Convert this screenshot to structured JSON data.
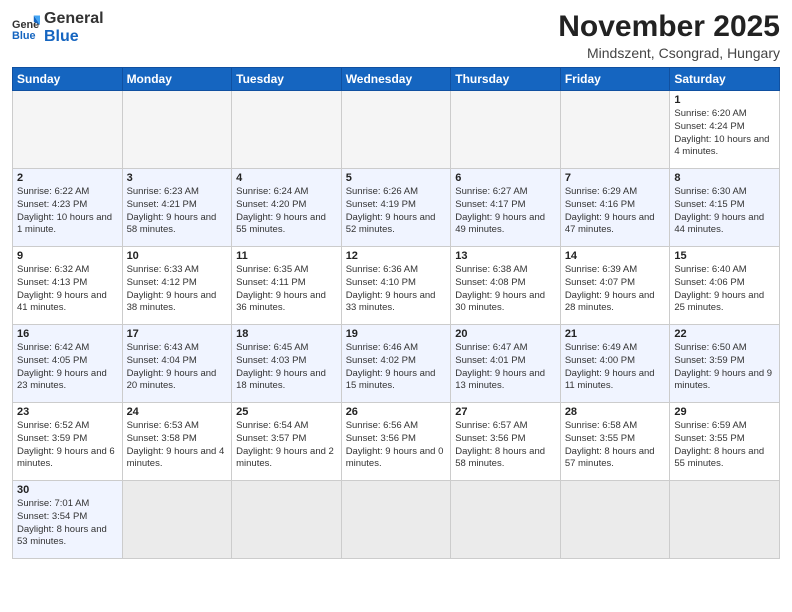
{
  "header": {
    "logo_general": "General",
    "logo_blue": "Blue",
    "title": "November 2025",
    "subtitle": "Mindszent, Csongrad, Hungary"
  },
  "weekdays": [
    "Sunday",
    "Monday",
    "Tuesday",
    "Wednesday",
    "Thursday",
    "Friday",
    "Saturday"
  ],
  "weeks": [
    [
      {
        "day": "",
        "info": ""
      },
      {
        "day": "",
        "info": ""
      },
      {
        "day": "",
        "info": ""
      },
      {
        "day": "",
        "info": ""
      },
      {
        "day": "",
        "info": ""
      },
      {
        "day": "",
        "info": ""
      },
      {
        "day": "1",
        "info": "Sunrise: 6:20 AM\nSunset: 4:24 PM\nDaylight: 10 hours\nand 4 minutes."
      }
    ],
    [
      {
        "day": "2",
        "info": "Sunrise: 6:22 AM\nSunset: 4:23 PM\nDaylight: 10 hours\nand 1 minute."
      },
      {
        "day": "3",
        "info": "Sunrise: 6:23 AM\nSunset: 4:21 PM\nDaylight: 9 hours\nand 58 minutes."
      },
      {
        "day": "4",
        "info": "Sunrise: 6:24 AM\nSunset: 4:20 PM\nDaylight: 9 hours\nand 55 minutes."
      },
      {
        "day": "5",
        "info": "Sunrise: 6:26 AM\nSunset: 4:19 PM\nDaylight: 9 hours\nand 52 minutes."
      },
      {
        "day": "6",
        "info": "Sunrise: 6:27 AM\nSunset: 4:17 PM\nDaylight: 9 hours\nand 49 minutes."
      },
      {
        "day": "7",
        "info": "Sunrise: 6:29 AM\nSunset: 4:16 PM\nDaylight: 9 hours\nand 47 minutes."
      },
      {
        "day": "8",
        "info": "Sunrise: 6:30 AM\nSunset: 4:15 PM\nDaylight: 9 hours\nand 44 minutes."
      }
    ],
    [
      {
        "day": "9",
        "info": "Sunrise: 6:32 AM\nSunset: 4:13 PM\nDaylight: 9 hours\nand 41 minutes."
      },
      {
        "day": "10",
        "info": "Sunrise: 6:33 AM\nSunset: 4:12 PM\nDaylight: 9 hours\nand 38 minutes."
      },
      {
        "day": "11",
        "info": "Sunrise: 6:35 AM\nSunset: 4:11 PM\nDaylight: 9 hours\nand 36 minutes."
      },
      {
        "day": "12",
        "info": "Sunrise: 6:36 AM\nSunset: 4:10 PM\nDaylight: 9 hours\nand 33 minutes."
      },
      {
        "day": "13",
        "info": "Sunrise: 6:38 AM\nSunset: 4:08 PM\nDaylight: 9 hours\nand 30 minutes."
      },
      {
        "day": "14",
        "info": "Sunrise: 6:39 AM\nSunset: 4:07 PM\nDaylight: 9 hours\nand 28 minutes."
      },
      {
        "day": "15",
        "info": "Sunrise: 6:40 AM\nSunset: 4:06 PM\nDaylight: 9 hours\nand 25 minutes."
      }
    ],
    [
      {
        "day": "16",
        "info": "Sunrise: 6:42 AM\nSunset: 4:05 PM\nDaylight: 9 hours\nand 23 minutes."
      },
      {
        "day": "17",
        "info": "Sunrise: 6:43 AM\nSunset: 4:04 PM\nDaylight: 9 hours\nand 20 minutes."
      },
      {
        "day": "18",
        "info": "Sunrise: 6:45 AM\nSunset: 4:03 PM\nDaylight: 9 hours\nand 18 minutes."
      },
      {
        "day": "19",
        "info": "Sunrise: 6:46 AM\nSunset: 4:02 PM\nDaylight: 9 hours\nand 15 minutes."
      },
      {
        "day": "20",
        "info": "Sunrise: 6:47 AM\nSunset: 4:01 PM\nDaylight: 9 hours\nand 13 minutes."
      },
      {
        "day": "21",
        "info": "Sunrise: 6:49 AM\nSunset: 4:00 PM\nDaylight: 9 hours\nand 11 minutes."
      },
      {
        "day": "22",
        "info": "Sunrise: 6:50 AM\nSunset: 3:59 PM\nDaylight: 9 hours\nand 9 minutes."
      }
    ],
    [
      {
        "day": "23",
        "info": "Sunrise: 6:52 AM\nSunset: 3:59 PM\nDaylight: 9 hours\nand 6 minutes."
      },
      {
        "day": "24",
        "info": "Sunrise: 6:53 AM\nSunset: 3:58 PM\nDaylight: 9 hours\nand 4 minutes."
      },
      {
        "day": "25",
        "info": "Sunrise: 6:54 AM\nSunset: 3:57 PM\nDaylight: 9 hours\nand 2 minutes."
      },
      {
        "day": "26",
        "info": "Sunrise: 6:56 AM\nSunset: 3:56 PM\nDaylight: 9 hours\nand 0 minutes."
      },
      {
        "day": "27",
        "info": "Sunrise: 6:57 AM\nSunset: 3:56 PM\nDaylight: 8 hours\nand 58 minutes."
      },
      {
        "day": "28",
        "info": "Sunrise: 6:58 AM\nSunset: 3:55 PM\nDaylight: 8 hours\nand 57 minutes."
      },
      {
        "day": "29",
        "info": "Sunrise: 6:59 AM\nSunset: 3:55 PM\nDaylight: 8 hours\nand 55 minutes."
      }
    ],
    [
      {
        "day": "30",
        "info": "Sunrise: 7:01 AM\nSunset: 3:54 PM\nDaylight: 8 hours\nand 53 minutes."
      },
      {
        "day": "",
        "info": ""
      },
      {
        "day": "",
        "info": ""
      },
      {
        "day": "",
        "info": ""
      },
      {
        "day": "",
        "info": ""
      },
      {
        "day": "",
        "info": ""
      },
      {
        "day": "",
        "info": ""
      }
    ]
  ]
}
